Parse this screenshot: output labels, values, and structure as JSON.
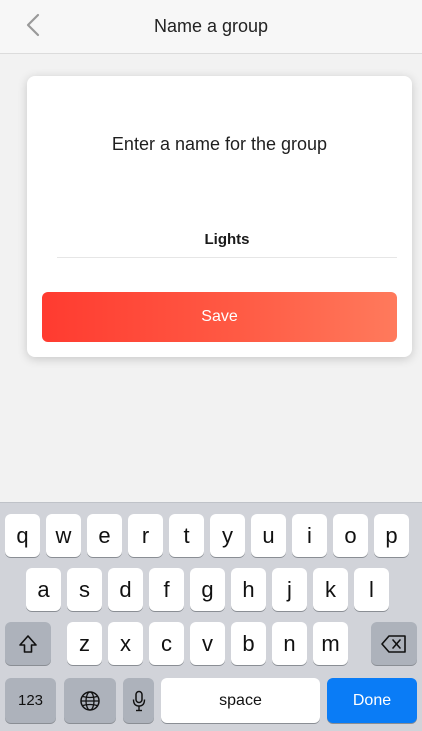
{
  "navbar": {
    "title": "Name a group",
    "back_icon": "chevron-left-icon"
  },
  "card": {
    "prompt": "Enter a name for the group",
    "input_value": "Lights",
    "save_label": "Save",
    "save_gradient": [
      "#ff3b30",
      "#ff7a5c"
    ]
  },
  "keyboard": {
    "row1": [
      "q",
      "w",
      "e",
      "r",
      "t",
      "y",
      "u",
      "i",
      "o",
      "p"
    ],
    "row2": [
      "a",
      "s",
      "d",
      "f",
      "g",
      "h",
      "j",
      "k",
      "l"
    ],
    "row3": [
      "z",
      "x",
      "c",
      "v",
      "b",
      "n",
      "m"
    ],
    "shift_icon": "shift-icon",
    "delete_icon": "delete-icon",
    "numbers_label": "123",
    "globe_icon": "globe-icon",
    "mic_icon": "microphone-icon",
    "space_label": "space",
    "done_label": "Done",
    "done_color": "#0a7cf6"
  }
}
